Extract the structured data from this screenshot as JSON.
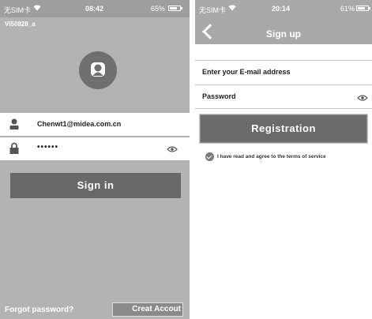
{
  "left": {
    "status": {
      "carrier": "无SIM卡",
      "time": "08:42",
      "battery": "65%"
    },
    "account_id": "VI50828_a",
    "username": "Chenwt1@midea.com.cn",
    "password_mask": "••••••",
    "signin_label": "Sign in",
    "forgot_label": "Forgot password?",
    "create_label": "Creat Accout",
    "icons": [
      "wifi-icon",
      "battery-icon",
      "avatar-icon",
      "user-icon",
      "lock-icon",
      "eye-icon"
    ]
  },
  "right": {
    "status": {
      "carrier": "无SIM卡",
      "time": "20:14",
      "battery": "61%"
    },
    "title": "Sign up",
    "email_placeholder": "Enter your E-mail address",
    "password_placeholder": "Password",
    "register_label": "Registration",
    "terms_label": "I have read and agree to the terms of service",
    "icons": [
      "back-chevron-icon",
      "eye-icon",
      "check-icon"
    ]
  },
  "colors": {
    "left_bg": "#b3b3b3",
    "header_gray": "#a9a9a9",
    "button_dark": "#686868",
    "white": "#ffffff"
  }
}
